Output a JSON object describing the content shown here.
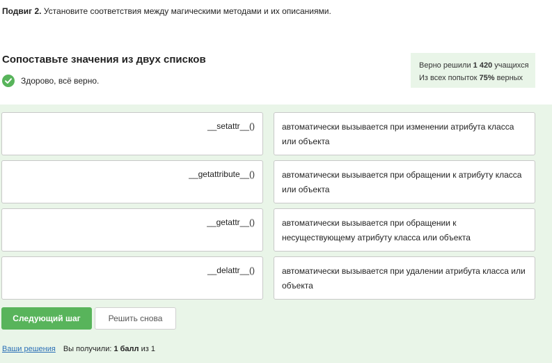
{
  "feature": {
    "label": "Подвиг 2.",
    "text": "Установите соответствия между магическими методами и их описаниями."
  },
  "task": {
    "title": "Сопоставьте значения из двух списков",
    "status": "Здорово, всё верно."
  },
  "stats": {
    "line1_prefix": "Верно решили",
    "line1_count": "1 420",
    "line1_suffix": "учащихся",
    "line2_prefix": "Из всех попыток",
    "line2_percent": "75%",
    "line2_suffix": "верных"
  },
  "pairs": [
    {
      "term": "__setattr__()",
      "definition": "автоматически вызывается при изменении атрибута класса или объекта"
    },
    {
      "term": "__getattribute__()",
      "definition": "автоматически вызывается при обращении к атрибуту класса или объекта"
    },
    {
      "term": "__getattr__()",
      "definition": "автоматически вызывается при обращении к несуществующему атрибуту класса или объекта"
    },
    {
      "term": "__delattr__()",
      "definition": "автоматически вызывается при удалении атрибута класса или объекта"
    }
  ],
  "buttons": {
    "next": "Следующий шаг",
    "retry": "Решить снова"
  },
  "footer": {
    "solutions_link": "Ваши решения",
    "score_prefix": "Вы получили:",
    "score_value": "1 балл",
    "score_suffix": "из 1"
  },
  "colors": {
    "accent": "#58b45b",
    "panel_bg": "#e9f5e8",
    "link": "#2a6fb6"
  },
  "icons": {
    "status": "check-circle-icon"
  }
}
